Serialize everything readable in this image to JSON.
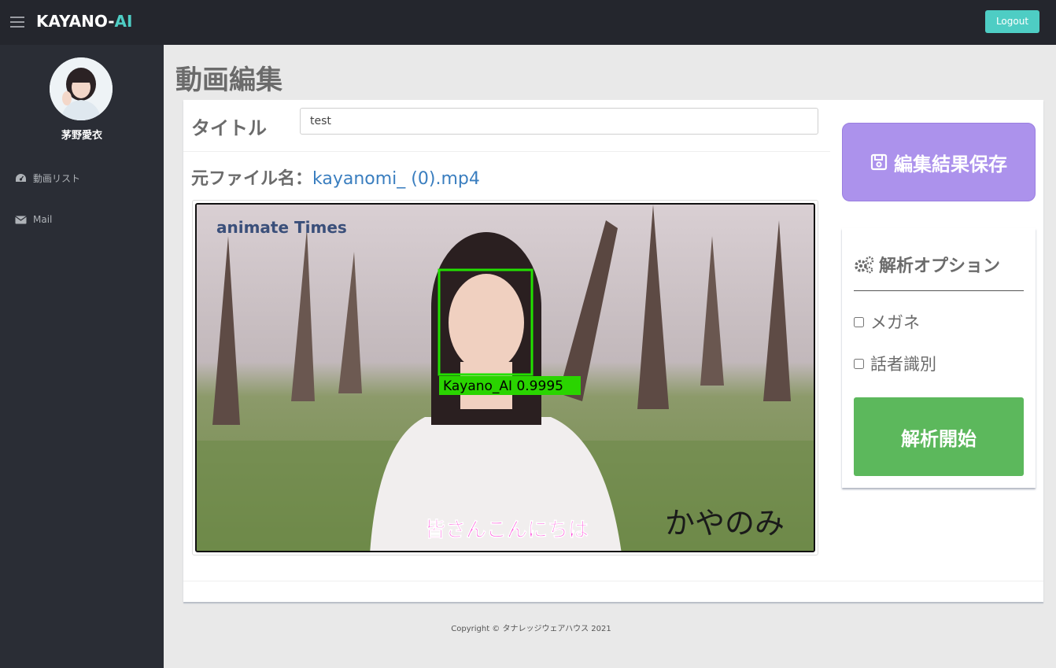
{
  "header": {
    "brand_main": "KAYANO-",
    "brand_accent": "AI",
    "logout_label": "Logout",
    "menu_icon": "hamburger-icon",
    "accent_color": "#4ecdc4"
  },
  "sidebar": {
    "profile_name": "茅野愛衣",
    "items": [
      {
        "label": "動画リスト",
        "icon": "dashboard-icon"
      },
      {
        "label": "Mail",
        "icon": "envelope-icon"
      }
    ]
  },
  "main": {
    "page_title": "動画編集",
    "title_label": "タイトル",
    "title_value": "test",
    "file_label": "元ファイル名：",
    "file_name": "kayanomi_ (0).mp4",
    "video": {
      "watermark": "animate Times",
      "detection_label": "Kayano_AI 0.9995",
      "subtitle": "皆さんこんにちは",
      "logo_text": "かやのみ"
    }
  },
  "actions": {
    "save_label": "編集結果保存",
    "save_icon": "floppy-disk-icon",
    "save_color": "#ac92ec"
  },
  "options": {
    "title": "解析オプション",
    "title_icon": "cogs-icon",
    "checkbox_1": "メガネ",
    "checkbox_2": "話者識別",
    "start_label": "解析開始",
    "start_color": "#5cb85c"
  },
  "footer": {
    "copyright": "Copyright © タナレッジウェアハウス 2021"
  }
}
